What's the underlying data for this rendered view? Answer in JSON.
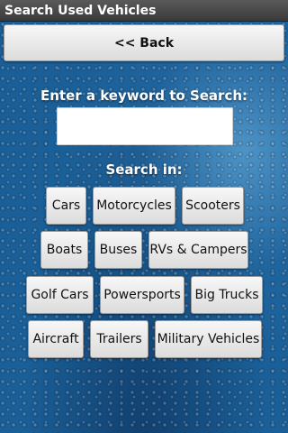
{
  "title_bar": {
    "title": "Search Used Vehicles"
  },
  "back_button": {
    "label": "<< Back"
  },
  "search": {
    "prompt": "Enter a keyword to Search:",
    "value": "",
    "placeholder": ""
  },
  "categories": {
    "heading": "Search in:",
    "items": [
      "Cars",
      "Motorcycles",
      "Scooters",
      "Boats",
      "Buses",
      "RVs & Campers",
      "Golf Cars",
      "Powersports",
      "Big Trucks",
      "Aircraft",
      "Trailers",
      "Military Vehicles"
    ]
  },
  "colors": {
    "background": "#1a5f97",
    "title_bar": "#4a4a4a",
    "button": "#e8e8e8"
  }
}
